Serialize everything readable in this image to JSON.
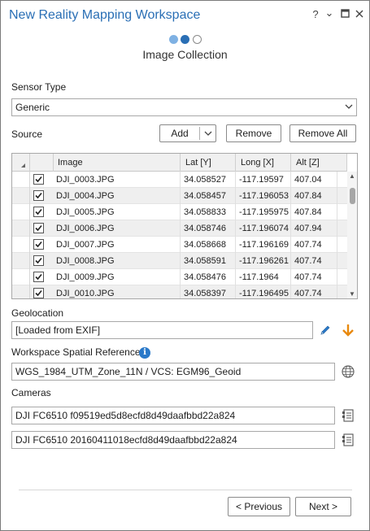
{
  "window": {
    "title": "New Reality Mapping Workspace",
    "help_glyph": "?",
    "menu_glyph": "⌄",
    "restore_glyph": "▭",
    "close_glyph": "✕"
  },
  "wizard": {
    "step_title": "Image Collection",
    "steps_total": 3,
    "current_step": 2
  },
  "sensor": {
    "label": "Sensor Type",
    "value": "Generic"
  },
  "source": {
    "label": "Source",
    "add_label": "Add",
    "remove_label": "Remove",
    "remove_all_label": "Remove All"
  },
  "table": {
    "columns": [
      "Image",
      "Lat [Y]",
      "Long [X]",
      "Alt [Z]"
    ],
    "rows": [
      {
        "checked": true,
        "image": "DJI_0003.JPG",
        "lat": "34.058527",
        "long": "-117.19597",
        "alt": "407.04"
      },
      {
        "checked": true,
        "image": "DJI_0004.JPG",
        "lat": "34.058457",
        "long": "-117.196053",
        "alt": "407.84"
      },
      {
        "checked": true,
        "image": "DJI_0005.JPG",
        "lat": "34.058833",
        "long": "-117.195975",
        "alt": "407.84"
      },
      {
        "checked": true,
        "image": "DJI_0006.JPG",
        "lat": "34.058746",
        "long": "-117.196074",
        "alt": "407.94"
      },
      {
        "checked": true,
        "image": "DJI_0007.JPG",
        "lat": "34.058668",
        "long": "-117.196169",
        "alt": "407.74"
      },
      {
        "checked": true,
        "image": "DJI_0008.JPG",
        "lat": "34.058591",
        "long": "-117.196261",
        "alt": "407.74"
      },
      {
        "checked": true,
        "image": "DJI_0009.JPG",
        "lat": "34.058476",
        "long": "-117.1964",
        "alt": "407.74"
      },
      {
        "checked": true,
        "image": "DJI_0010.JPG",
        "lat": "34.058397",
        "long": "-117.196495",
        "alt": "407.74"
      }
    ]
  },
  "geolocation": {
    "label": "Geolocation",
    "value": "[Loaded from EXIF]"
  },
  "spatial_reference": {
    "label": "Workspace Spatial Reference",
    "value": "WGS_1984_UTM_Zone_11N / VCS: EGM96_Geoid"
  },
  "cameras": {
    "label": "Cameras",
    "items": [
      "DJI FC6510 f09519ed5d8ecfd8d49daafbbd22a824",
      "DJI FC6510 20160411018ecfd8d49daafbbd22a824"
    ]
  },
  "footer": {
    "previous_label": "< Previous",
    "next_label": "Next >"
  },
  "icons": {
    "info": "info-icon",
    "edit": "pencil-icon",
    "import": "arrow-down-icon",
    "globe": "globe-icon",
    "properties": "properties-icon"
  },
  "colors": {
    "accent": "#2a6fb5",
    "orange": "#e8890c"
  }
}
